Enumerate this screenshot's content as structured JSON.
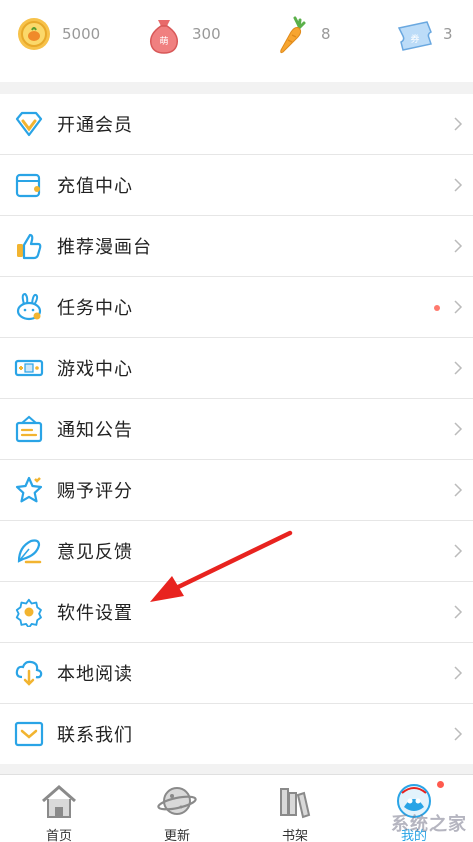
{
  "stats": [
    {
      "icon": "coin-icon",
      "value": "5000"
    },
    {
      "icon": "money-bag-icon",
      "value": "300",
      "badge": "萌"
    },
    {
      "icon": "carrot-icon",
      "value": "8"
    },
    {
      "icon": "ticket-icon",
      "value": "3",
      "badge": "券"
    }
  ],
  "menu": [
    {
      "label": "开通会员",
      "icon": "vip-diamond-icon"
    },
    {
      "label": "充值中心",
      "icon": "wallet-icon"
    },
    {
      "label": "推荐漫画台",
      "icon": "thumbs-up-icon"
    },
    {
      "label": "任务中心",
      "icon": "rabbit-icon",
      "has_dot": true
    },
    {
      "label": "游戏中心",
      "icon": "gamepad-icon"
    },
    {
      "label": "通知公告",
      "icon": "notice-board-icon"
    },
    {
      "label": "赐予评分",
      "icon": "star-icon"
    },
    {
      "label": "意见反馈",
      "icon": "feather-pen-icon"
    },
    {
      "label": "软件设置",
      "icon": "gear-icon"
    },
    {
      "label": "本地阅读",
      "icon": "cloud-download-icon"
    },
    {
      "label": "联系我们",
      "icon": "mail-icon"
    }
  ],
  "tabs": [
    {
      "label": "首页",
      "icon": "home-icon"
    },
    {
      "label": "更新",
      "icon": "planet-icon"
    },
    {
      "label": "书架",
      "icon": "bookshelf-icon"
    },
    {
      "label": "我的",
      "icon": "profile-avatar-icon",
      "active": true
    }
  ],
  "watermark": "系统之家",
  "colors": {
    "accent": "#2aa4e6",
    "dot": "#ff7a6e",
    "arrow": "#e8231f"
  }
}
